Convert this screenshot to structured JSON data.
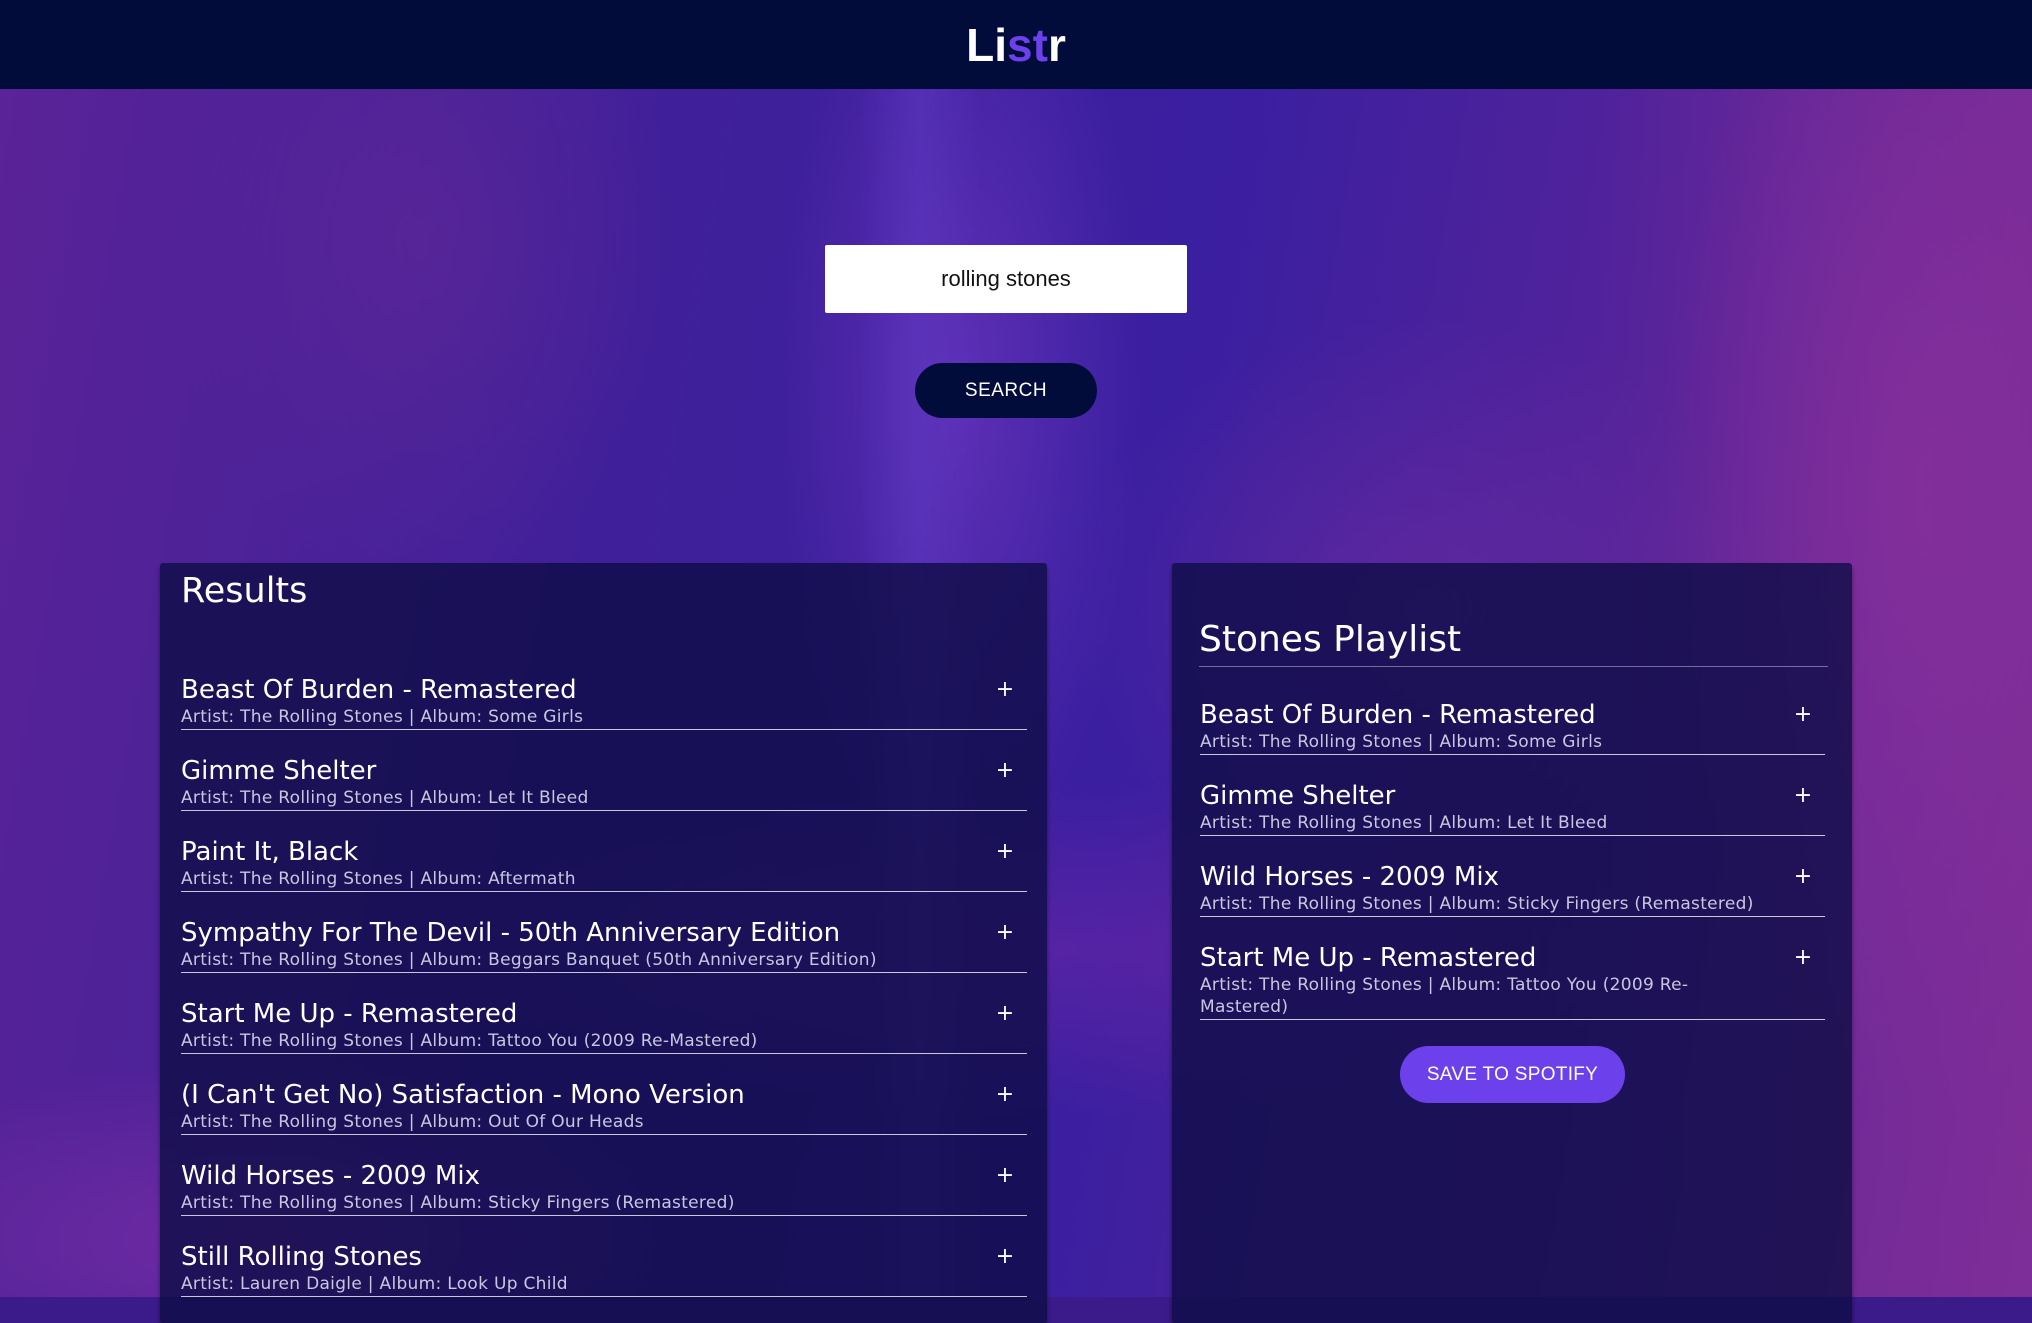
{
  "app": {
    "logo_prefix": "Li",
    "logo_accent": "st",
    "logo_suffix": "r",
    "accent_color": "#6c41ec",
    "header_color": "#010c3b"
  },
  "search": {
    "value": "rolling stones",
    "button_label": "SEARCH"
  },
  "results": {
    "title": "Results",
    "tracks": [
      {
        "name": "Beast Of Burden - Remastered",
        "info": "Artist: The Rolling Stones | Album: Some Girls",
        "action": "+"
      },
      {
        "name": "Gimme Shelter",
        "info": "Artist: The Rolling Stones | Album: Let It Bleed",
        "action": "+"
      },
      {
        "name": "Paint It, Black",
        "info": "Artist: The Rolling Stones | Album: Aftermath",
        "action": "+"
      },
      {
        "name": "Sympathy For The Devil - 50th Anniversary Edition",
        "info": "Artist: The Rolling Stones | Album: Beggars Banquet (50th Anniversary Edition)",
        "action": "+"
      },
      {
        "name": "Start Me Up - Remastered",
        "info": "Artist: The Rolling Stones | Album: Tattoo You (2009 Re-Mastered)",
        "action": "+"
      },
      {
        "name": "(I Can't Get No) Satisfaction - Mono Version",
        "info": "Artist: The Rolling Stones | Album: Out Of Our Heads",
        "action": "+"
      },
      {
        "name": "Wild Horses - 2009 Mix",
        "info": "Artist: The Rolling Stones | Album: Sticky Fingers (Remastered)",
        "action": "+"
      },
      {
        "name": "Still Rolling Stones",
        "info": "Artist: Lauren Daigle | Album: Look Up Child",
        "action": "+"
      }
    ]
  },
  "playlist": {
    "name": "Stones Playlist",
    "save_label": "SAVE TO SPOTIFY",
    "tracks": [
      {
        "name": "Beast Of Burden - Remastered",
        "info": "Artist: The Rolling Stones | Album: Some Girls",
        "action": "+"
      },
      {
        "name": "Gimme Shelter",
        "info": "Artist: The Rolling Stones | Album: Let It Bleed",
        "action": "+"
      },
      {
        "name": "Wild Horses - 2009 Mix",
        "info": "Artist: The Rolling Stones | Album: Sticky Fingers (Remastered)",
        "action": "+"
      },
      {
        "name": "Start Me Up - Remastered",
        "info": "Artist: The Rolling Stones | Album: Tattoo You (2009 Re-Mastered)",
        "action": "+"
      }
    ]
  }
}
